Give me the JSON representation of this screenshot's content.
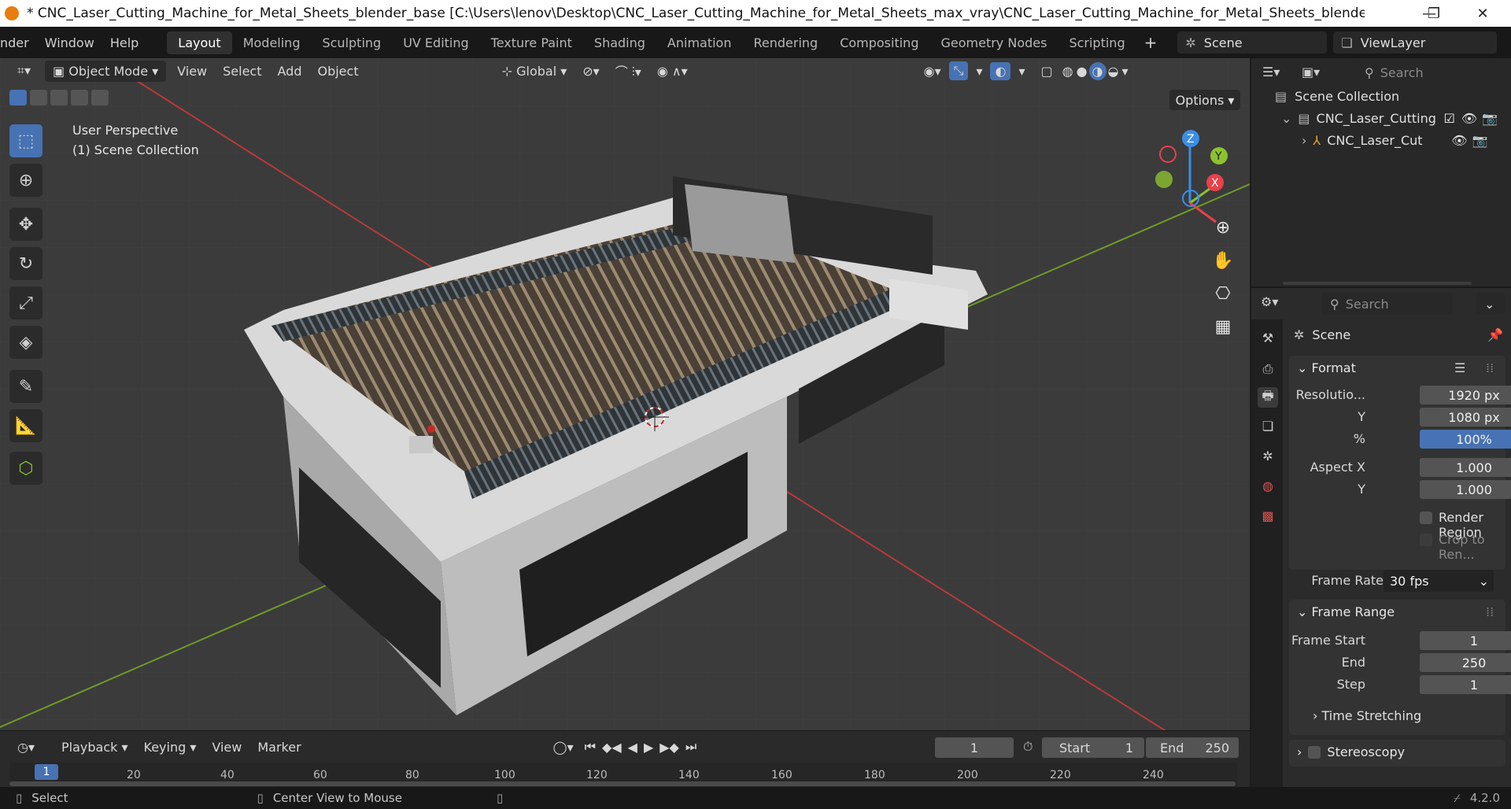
{
  "window": {
    "title": "* CNC_Laser_Cutting_Machine_for_Metal_Sheets_blender_base [C:\\Users\\lenov\\Desktop\\CNC_Laser_Cutting_Machine_for_Metal_Sheets_max_vray\\CNC_Laser_Cutting_Machine_for_Metal_Sheets_blender_base.blend] - Blender ...",
    "minimize": "—",
    "maximize": "❐",
    "close": "✕"
  },
  "menu": {
    "items": [
      "nder",
      "Window",
      "Help"
    ],
    "workspaces": [
      "Layout",
      "Modeling",
      "Sculpting",
      "UV Editing",
      "Texture Paint",
      "Shading",
      "Animation",
      "Rendering",
      "Compositing",
      "Geometry Nodes",
      "Scripting"
    ],
    "active_workspace": "Layout",
    "add_workspace": "+",
    "scene": "Scene",
    "view_layer": "ViewLayer"
  },
  "viewport": {
    "mode": "Object Mode",
    "menus": [
      "View",
      "Select",
      "Add",
      "Object"
    ],
    "transform_orientation": "Global",
    "options": "Options",
    "overlay_line1": "User Perspective",
    "overlay_line2": "(1) Scene Collection",
    "gizmo": {
      "z": "Z",
      "y": "Y",
      "x": "X"
    }
  },
  "outliner": {
    "search_placeholder": "Search",
    "root": "Scene Collection",
    "collection": "CNC_Laser_Cutting",
    "object": "CNC_Laser_Cut"
  },
  "properties": {
    "search_placeholder": "Search",
    "context": "Scene",
    "format": {
      "header": "Format",
      "resolution_label": "Resolutio...",
      "res_x": "1920 px",
      "y_label": "Y",
      "res_y": "1080 px",
      "pct_label": "%",
      "res_pct": "100%",
      "aspect_label": "Aspect X",
      "aspect_x": "1.000",
      "aspect_y_label": "Y",
      "aspect_y": "1.000",
      "render_region": "Render Region",
      "crop": "Crop to Ren...",
      "frame_rate_label": "Frame Rate",
      "frame_rate": "30 fps"
    },
    "frame_range": {
      "header": "Frame Range",
      "start_label": "Frame Start",
      "start": "1",
      "end_label": "End",
      "end": "250",
      "step_label": "Step",
      "step": "1"
    },
    "time_stretching": "Time Stretching",
    "stereoscopy": "Stereoscopy"
  },
  "timeline": {
    "menus": [
      "Playback",
      "Keying",
      "View",
      "Marker"
    ],
    "current_frame": "1",
    "start_label": "Start",
    "start": "1",
    "end_label": "End",
    "end": "250",
    "ruler": [
      "1",
      "20",
      "40",
      "60",
      "80",
      "100",
      "120",
      "140",
      "160",
      "180",
      "200",
      "220",
      "240"
    ]
  },
  "status": {
    "select": "Select",
    "center_view": "Center View to Mouse",
    "version": "4.2.0"
  },
  "colors": {
    "accent": "#4772b3",
    "axis_x": "#e8414b",
    "axis_y": "#8cc22f",
    "axis_z": "#3a8ee6"
  }
}
